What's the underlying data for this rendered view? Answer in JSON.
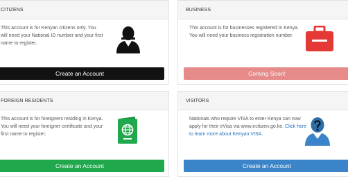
{
  "colors": {
    "black": "#121212",
    "red": "#e53935",
    "red_disabled": "#e68a8a",
    "green": "#20a84c",
    "blue": "#3b84c9",
    "link": "#1f6fb9"
  },
  "cards": {
    "citizens": {
      "title": "CITIZENS",
      "text": "This account is for Kenyan citizens only. You will need your National ID number and your first name to register.",
      "button": "Create an Account",
      "icon": "person-silhouette-icon"
    },
    "business": {
      "title": "BUSINESS",
      "text": "This account is for businesses registered in Kenya. You will need your business registration number.",
      "button": "Coming Soon!",
      "icon": "briefcase-icon"
    },
    "foreign": {
      "title": "FOREIGN RESIDENTS",
      "text": "This account is for foreigners residing in Kenya. You will need your foreigner certificate and your first name to register.",
      "button": "Create an Account",
      "icon": "passport-icon"
    },
    "visitors": {
      "title": "VISITORS",
      "text": "Nationals who require VISA to enter Kenya can now apply for their eVisa via www.ecitizen.go.ke.",
      "link": "Click here to learn more about Kenyan VISA.",
      "button": "Create an Account",
      "icon": "visitor-question-icon"
    }
  }
}
